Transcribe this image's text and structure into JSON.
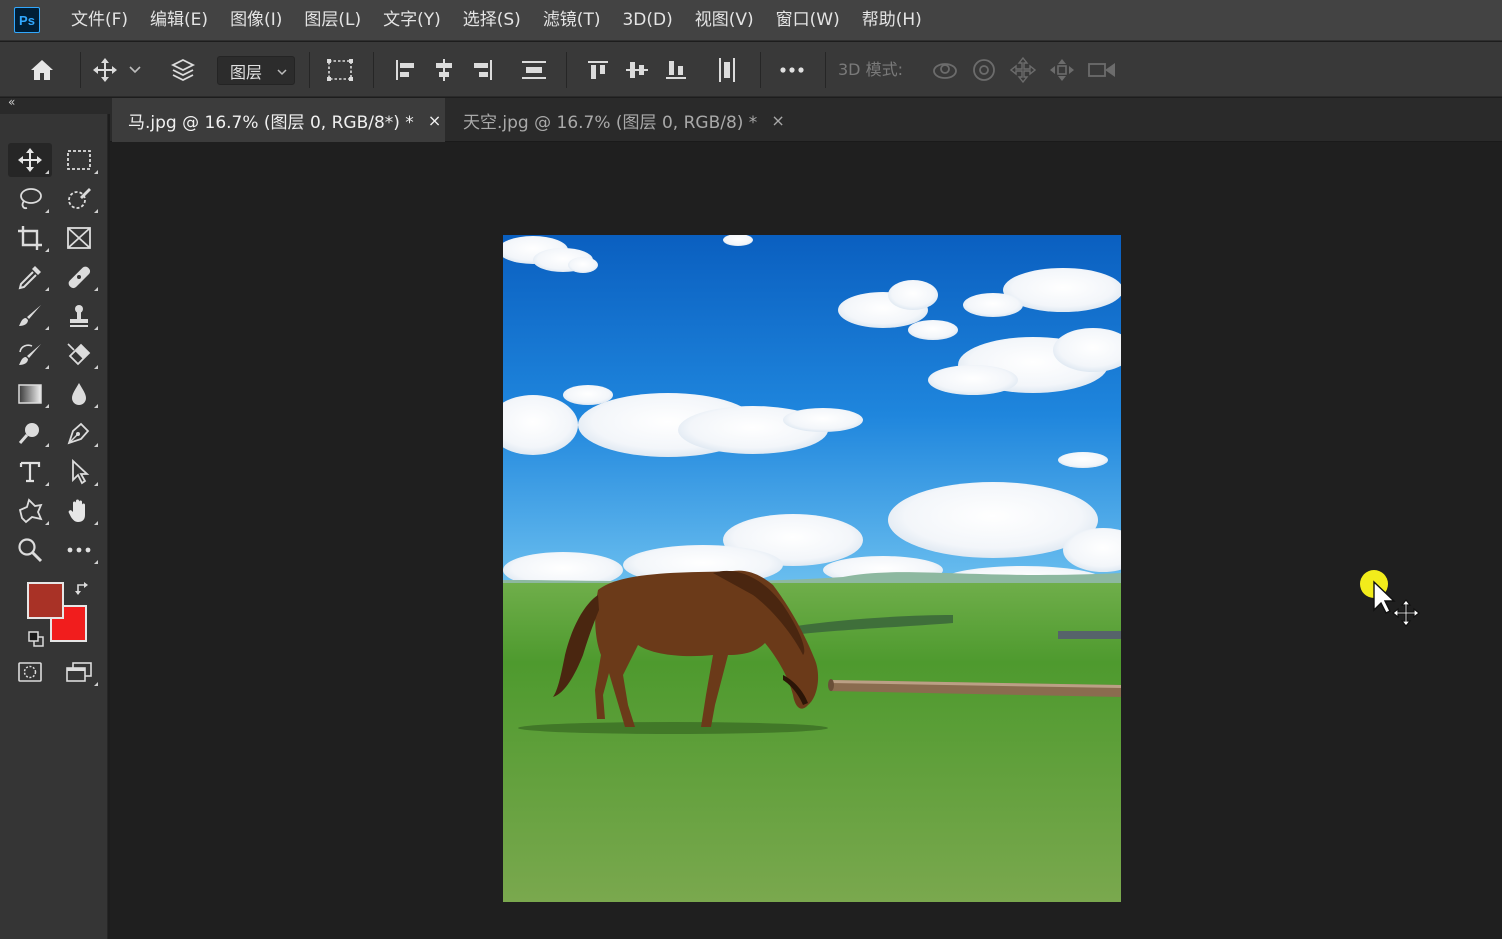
{
  "app": {
    "logo_text": "Ps"
  },
  "menu": [
    "文件(F)",
    "编辑(E)",
    "图像(I)",
    "图层(L)",
    "文字(Y)",
    "选择(S)",
    "滤镜(T)",
    "3D(D)",
    "视图(V)",
    "窗口(W)",
    "帮助(H)"
  ],
  "options_bar": {
    "auto_select_target": "图层",
    "mode_3d_label": "3D 模式:"
  },
  "toolbar": {
    "collapse_glyph": "«",
    "foreground_color": "#a93226",
    "background_color": "#f11d1d"
  },
  "tabs": [
    {
      "title": "马.jpg @ 16.7% (图层 0, RGB/8*) *",
      "close": "×",
      "active": true
    },
    {
      "title": "天空.jpg @ 16.7% (图层 0, RGB/8) *",
      "close": "×",
      "active": false
    }
  ],
  "canvas": {
    "background": "#1f1f1f",
    "document_content": "photo: brown horse grazing on green grassland under blue sky with white clouds"
  }
}
